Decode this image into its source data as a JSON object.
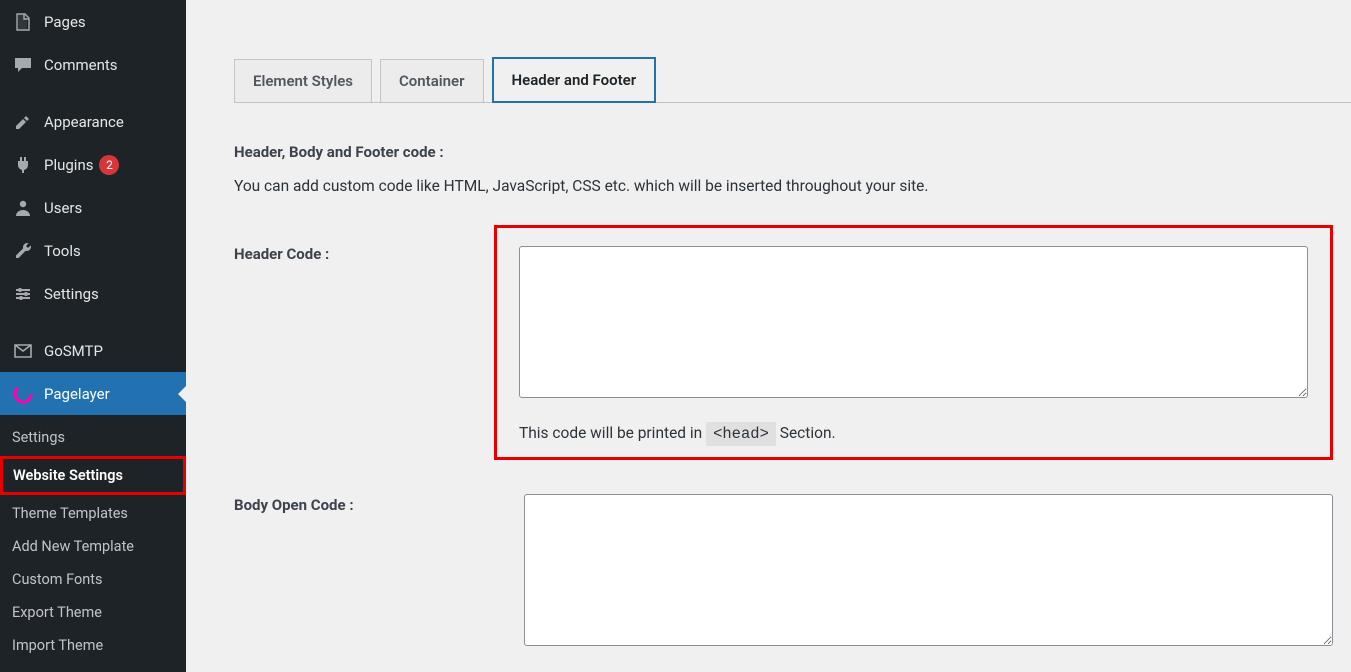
{
  "sidebar": {
    "items": [
      {
        "label": "Pages"
      },
      {
        "label": "Comments"
      },
      {
        "label": "Appearance"
      },
      {
        "label": "Plugins",
        "badge": "2"
      },
      {
        "label": "Users"
      },
      {
        "label": "Tools"
      },
      {
        "label": "Settings"
      },
      {
        "label": "GoSMTP"
      },
      {
        "label": "Pagelayer"
      }
    ],
    "submenu": [
      {
        "label": "Settings"
      },
      {
        "label": "Website Settings"
      },
      {
        "label": "Theme Templates"
      },
      {
        "label": "Add New Template"
      },
      {
        "label": "Custom Fonts"
      },
      {
        "label": "Export Theme"
      },
      {
        "label": "Import Theme"
      }
    ]
  },
  "tabs": [
    {
      "label": "Element Styles"
    },
    {
      "label": "Container"
    },
    {
      "label": "Header and Footer"
    }
  ],
  "main": {
    "section_title": "Header, Body and Footer code :",
    "section_desc": "You can add custom code like HTML, JavaScript, CSS etc. which will be inserted throughout your site.",
    "header_code_label": "Header Code :",
    "header_code_value": "",
    "header_hint_pre": "This code will be printed in ",
    "header_hint_code": "<head>",
    "header_hint_post": " Section.",
    "body_open_label": "Body Open Code :",
    "body_open_value": ""
  }
}
